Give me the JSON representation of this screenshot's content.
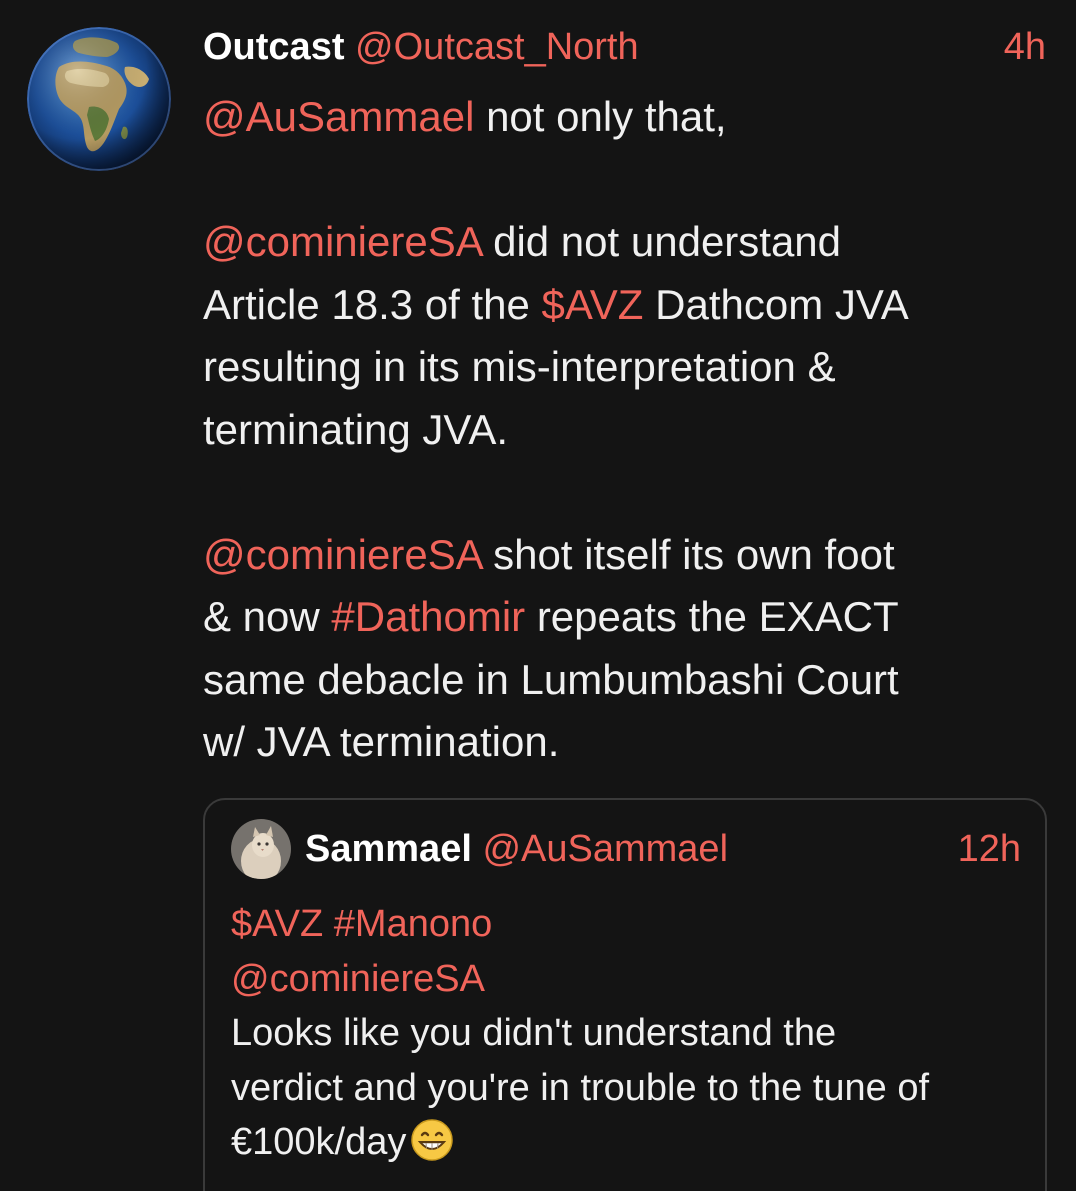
{
  "tweet": {
    "author_name": "Outcast",
    "author_handle": "@Outcast_North",
    "timestamp": "4h",
    "reply_to": "@AuSammael",
    "line1_rest": " not only that,",
    "p2_mention": "@cominiereSA",
    "p2_line1_rest": " did not understand",
    "p2_line2_pre": "Article 18.3 of the ",
    "p2_cashtag": "$AVZ",
    "p2_line2_post": " Dathcom JVA",
    "p2_line3": "resulting in its mis-interpretation &",
    "p2_line4": "terminating JVA.",
    "p3_mention": "@cominiereSA",
    "p3_line1_rest": " shot itself its own foot",
    "p3_line2_pre": "& now ",
    "p3_hashtag": "#Dathomir",
    "p3_line2_post": " repeats the EXACT",
    "p3_line3": "same debacle in Lumbumbashi Court",
    "p3_line4": "w/ JVA termination."
  },
  "quoted_tweet": {
    "author_name": "Sammael",
    "author_handle": "@AuSammael",
    "timestamp": "12h",
    "cashtag": "$AVZ",
    "hashtag": "#Manono",
    "mention": "@cominiereSA",
    "line1": "Looks like you didn't understand the",
    "line2": "verdict and you're in trouble to the tune of",
    "line3": "€100k/day"
  },
  "icons": {
    "author_avatar": "earth-globe-avatar",
    "quoted_avatar": "cat-avatar",
    "emoji": "grinning-face-emoji"
  },
  "colors": {
    "background": "#141414",
    "accent": "#f0645a",
    "text": "#f0f0f0"
  }
}
